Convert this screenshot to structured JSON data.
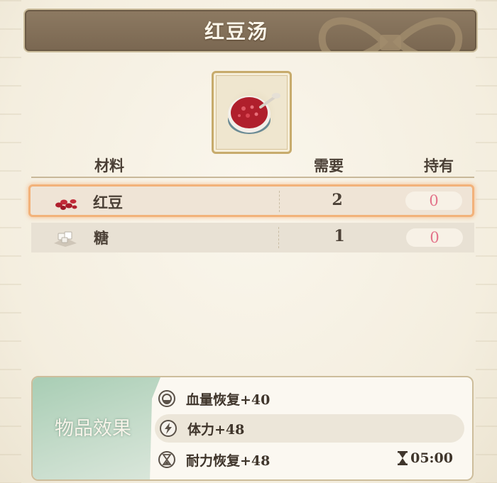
{
  "recipe": {
    "title": "红豆汤",
    "dish_icon": "red-bean-soup-icon"
  },
  "table": {
    "headers": {
      "material": "材料",
      "need": "需要",
      "have": "持有"
    },
    "rows": [
      {
        "name": "红豆",
        "need": "2",
        "have": "0",
        "icon": "red-beans-icon",
        "selected": true
      },
      {
        "name": "糖",
        "need": "1",
        "have": "0",
        "icon": "sugar-icon",
        "selected": false
      }
    ]
  },
  "effects": {
    "label": "物品效果",
    "items": [
      {
        "text": "血量恢复+40",
        "icon": "health-icon"
      },
      {
        "text": "体力+48",
        "icon": "energy-bolt-icon"
      },
      {
        "text": "耐力恢复+48",
        "icon": "hourglass-icon"
      }
    ],
    "timer": "05:00"
  },
  "colors": {
    "header_bg": "#7a6751",
    "highlight_border": "#f2b27a",
    "zero_count": "#e3738a",
    "effects_accent": "#a8cdb4"
  }
}
